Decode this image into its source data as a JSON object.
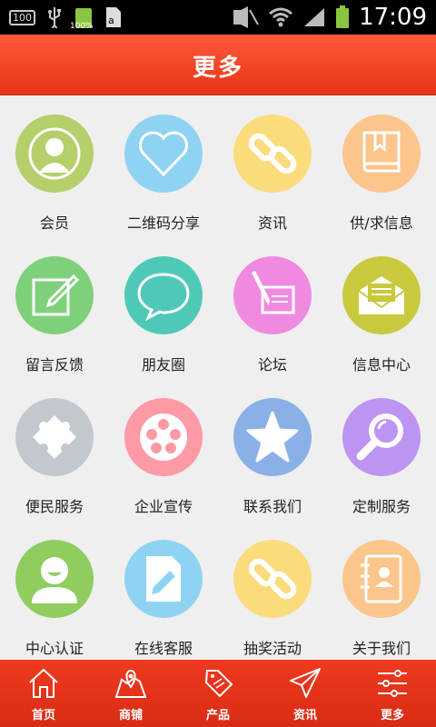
{
  "status_bar": {
    "notification_badge": "100",
    "battery_small_label": "100%",
    "time": "17:09"
  },
  "header": {
    "title": "更多"
  },
  "grid": {
    "items": [
      {
        "label": "会员",
        "icon": "member-icon",
        "color": "#b5cf6a"
      },
      {
        "label": "二维码分享",
        "icon": "heart-icon",
        "color": "#8fd3f3"
      },
      {
        "label": "资讯",
        "icon": "link-icon",
        "color": "#fbdb7b"
      },
      {
        "label": "供/求信息",
        "icon": "book-icon",
        "color": "#fbc58b"
      },
      {
        "label": "留言反馈",
        "icon": "edit-icon",
        "color": "#7fd07a"
      },
      {
        "label": "朋友圈",
        "icon": "chat-bubble-icon",
        "color": "#4fc9b7"
      },
      {
        "label": "论坛",
        "icon": "pen-paper-icon",
        "color": "#f08ae0"
      },
      {
        "label": "信息中心",
        "icon": "envelope-icon",
        "color": "#c8c93d"
      },
      {
        "label": "便民服务",
        "icon": "puzzle-icon",
        "color": "#c2c8ce"
      },
      {
        "label": "企业宣传",
        "icon": "film-reel-icon",
        "color": "#fd9aa6"
      },
      {
        "label": "联系我们",
        "icon": "star-icon",
        "color": "#8ab0e8"
      },
      {
        "label": "定制服务",
        "icon": "magnifier-icon",
        "color": "#bd94f2"
      },
      {
        "label": "中心认证",
        "icon": "user-smile-icon",
        "color": "#8fcd5f"
      },
      {
        "label": "在线客服",
        "icon": "document-pen-icon",
        "color": "#8fd3f3"
      },
      {
        "label": "抽奖活动",
        "icon": "link-icon",
        "color": "#fbdb7b"
      },
      {
        "label": "关于我们",
        "icon": "contact-book-icon",
        "color": "#fbc58b"
      }
    ]
  },
  "bottom_nav": {
    "items": [
      {
        "label": "首页",
        "icon": "home-icon"
      },
      {
        "label": "商铺",
        "icon": "store-map-icon"
      },
      {
        "label": "产品",
        "icon": "sale-tag-icon"
      },
      {
        "label": "资讯",
        "icon": "paper-plane-icon"
      },
      {
        "label": "更多",
        "icon": "sliders-icon"
      }
    ]
  }
}
